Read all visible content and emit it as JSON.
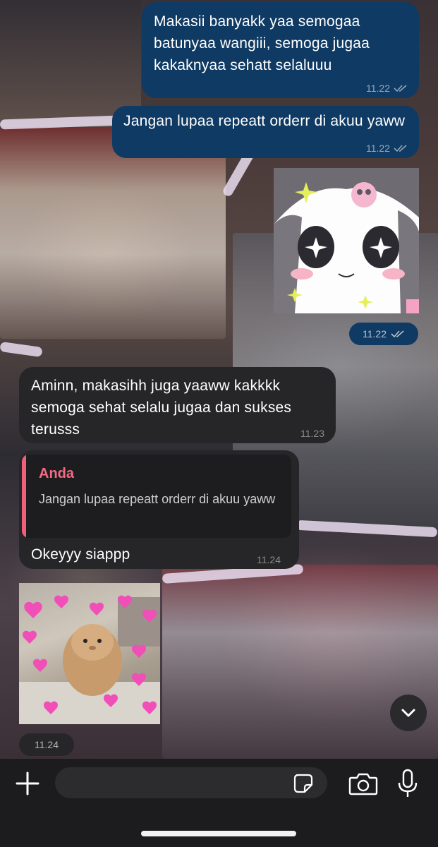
{
  "messages": [
    {
      "id": "m1",
      "text": "Makasii banyakk yaa semogaa batunyaa wangiii, semoga jugaa kakaknyaa sehatt selaluuu",
      "time": "11.22"
    },
    {
      "id": "m2",
      "text": "Jangan lupaa repeatt orderr di akuu yaww",
      "time": "11.22"
    },
    {
      "id": "m3",
      "time": "11.22"
    },
    {
      "id": "m4",
      "text": "Aminn, makasihh juga yaaww kakkkk semoga sehat selalu jugaa dan sukses terusss",
      "time": "11.23"
    },
    {
      "id": "m5",
      "quote_author": "Anda",
      "quote_text": "Jangan lupaa repeatt orderr di akuu yaww",
      "text": "Okeyyy siappp",
      "time": "11.24"
    },
    {
      "id": "m6",
      "time": "11.24"
    }
  ],
  "composer": {
    "placeholder": ""
  },
  "icons": {
    "attach": "plus-icon",
    "sticker": "sticker-icon",
    "camera": "camera-icon",
    "mic": "microphone-icon",
    "scroll": "chevron-down-icon",
    "read": "double-check-icon"
  },
  "colors": {
    "outgoing_bubble": "#0f3a63",
    "incoming_bubble": "#262628",
    "quote_accent": "#f0607a",
    "composer_bg": "#1c1c1e"
  }
}
